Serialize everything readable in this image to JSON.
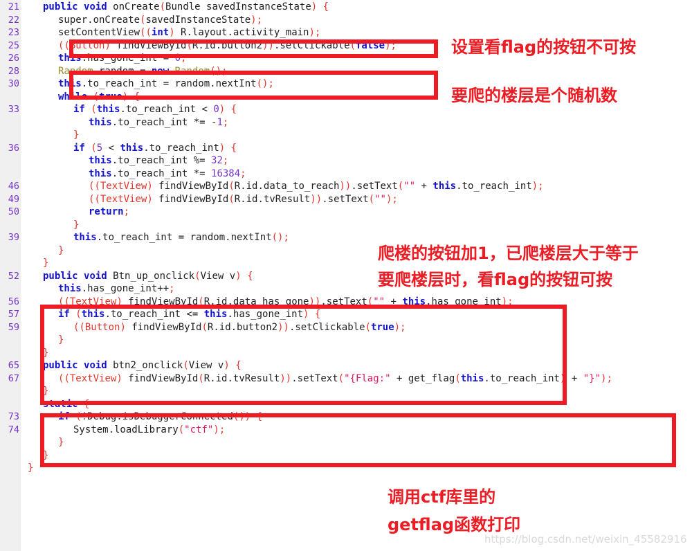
{
  "editor": {
    "gutter_label": "line-numbers",
    "line_numbers": [
      "21",
      "22",
      "23",
      "25",
      "26",
      "28",
      "30",
      "33",
      "36",
      "46",
      "49",
      "50",
      "39",
      "52",
      "56",
      "57",
      "59",
      "65",
      "67",
      "73",
      "74"
    ],
    "lines": [
      {
        "n": "21",
        "indent": 1,
        "text": "public void onCreate(Bundle savedInstanceState) {"
      },
      {
        "n": "22",
        "indent": 2,
        "text": "super.onCreate(savedInstanceState);"
      },
      {
        "n": "23",
        "indent": 2,
        "text": "setContentView((int) R.layout.activity_main);"
      },
      {
        "n": "25",
        "indent": 2,
        "text": "((Button) findViewById(R.id.button2)).setClickable(false);"
      },
      {
        "n": "26",
        "indent": 2,
        "text": "this.has_gone_int = 0;"
      },
      {
        "n": "28",
        "indent": 2,
        "text": "Random random = new Random();"
      },
      {
        "n": "30",
        "indent": 2,
        "text": "this.to_reach_int = random.nextInt();"
      },
      {
        "n": "",
        "indent": 2,
        "text": "while (true) {"
      },
      {
        "n": "33",
        "indent": 3,
        "text": "if (this.to_reach_int < 0) {"
      },
      {
        "n": "",
        "indent": 4,
        "text": "this.to_reach_int *= -1;"
      },
      {
        "n": "",
        "indent": 3,
        "text": "}"
      },
      {
        "n": "36",
        "indent": 3,
        "text": "if (5 < this.to_reach_int) {"
      },
      {
        "n": "",
        "indent": 4,
        "text": "this.to_reach_int %= 32;"
      },
      {
        "n": "",
        "indent": 4,
        "text": "this.to_reach_int *= 16384;"
      },
      {
        "n": "46",
        "indent": 4,
        "text": "((TextView) findViewById(R.id.data_to_reach)).setText(\"\" + this.to_reach_int);"
      },
      {
        "n": "49",
        "indent": 4,
        "text": "((TextView) findViewById(R.id.tvResult)).setText(\"\");"
      },
      {
        "n": "50",
        "indent": 4,
        "text": "return;"
      },
      {
        "n": "",
        "indent": 3,
        "text": "}"
      },
      {
        "n": "39",
        "indent": 3,
        "text": "this.to_reach_int = random.nextInt();"
      },
      {
        "n": "",
        "indent": 2,
        "text": "}"
      },
      {
        "n": "",
        "indent": 1,
        "text": "}"
      },
      {
        "n": "52",
        "indent": 1,
        "text": "public void Btn_up_onclick(View v) {"
      },
      {
        "n": "",
        "indent": 2,
        "text": "this.has_gone_int++;"
      },
      {
        "n": "56",
        "indent": 2,
        "text": "((TextView) findViewById(R.id.data_has_gone)).setText(\"\" + this.has_gone_int);"
      },
      {
        "n": "57",
        "indent": 2,
        "text": "if (this.to_reach_int <= this.has_gone_int) {"
      },
      {
        "n": "59",
        "indent": 3,
        "text": "((Button) findViewById(R.id.button2)).setClickable(true);"
      },
      {
        "n": "",
        "indent": 2,
        "text": "}"
      },
      {
        "n": "",
        "indent": 1,
        "text": "}"
      },
      {
        "n": "65",
        "indent": 1,
        "text": "public void btn2_onclick(View v) {"
      },
      {
        "n": "67",
        "indent": 2,
        "text": "((TextView) findViewById(R.id.tvResult)).setText(\"{Flag:\" + get_flag(this.to_reach_int) + \"}\");"
      },
      {
        "n": "",
        "indent": 1,
        "text": "}"
      },
      {
        "n": "",
        "indent": 1,
        "text": "static {"
      },
      {
        "n": "73",
        "indent": 2,
        "text": "if (!Debug.isDebuggerConnected()) {"
      },
      {
        "n": "74",
        "indent": 3,
        "text": "System.loadLibrary(\"ctf\");"
      },
      {
        "n": "",
        "indent": 2,
        "text": "}"
      },
      {
        "n": "",
        "indent": 1,
        "text": "}"
      },
      {
        "n": "",
        "indent": 0,
        "text": "}"
      }
    ]
  },
  "annotations": {
    "note1": "设置看flag的按钮不可按",
    "note2": "要爬的楼层是个随机数",
    "note3_line1": "爬楼的按钮加1，已爬楼层大于等于",
    "note3_line2": "要爬楼层时，看flag的按钮可按",
    "note4_line1": "调用ctf库里的",
    "note4_line2": "getflag函数打印"
  },
  "highlight_boxes": [
    {
      "name": "box-setclickable-false"
    },
    {
      "name": "box-random-int"
    },
    {
      "name": "box-btn-up-onclick"
    },
    {
      "name": "box-btn2-onclick"
    }
  ],
  "watermark": {
    "text": "https://blog.csdn.net/weixin_45582916"
  },
  "colors": {
    "annotation_red": "#ec1c24",
    "box_red": "#ed1c24",
    "line_number": "#7433c8",
    "gutter_bg": "#f0f0f0",
    "keyword": "#1414cc",
    "type": "#9a8b2e",
    "punctuation": "#e0352b",
    "string": "#e0145f",
    "number": "#7433c8"
  }
}
